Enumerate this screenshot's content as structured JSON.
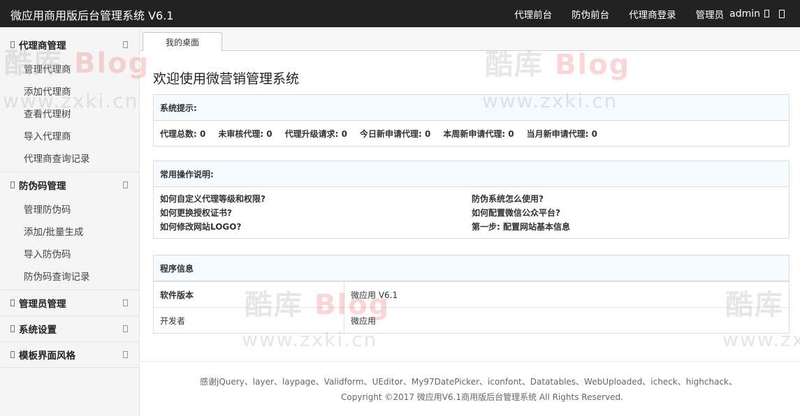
{
  "header": {
    "title": "微应用商用版后台管理系统 V6.1",
    "nav": [
      "代理前台",
      "防伪前台",
      "代理商登录"
    ],
    "role": "管理员",
    "user": "admin"
  },
  "sidebar": {
    "groups": [
      {
        "label": "代理商管理",
        "items": [
          "管理代理商",
          "添加代理商",
          "查看代理树",
          "导入代理商",
          "代理商查询记录"
        ]
      },
      {
        "label": "防伪码管理",
        "items": [
          "管理防伪码",
          "添加/批量生成",
          "导入防伪码",
          "防伪码查询记录"
        ]
      },
      {
        "label": "管理员管理",
        "items": []
      },
      {
        "label": "系统设置",
        "items": []
      },
      {
        "label": "模板界面风格",
        "items": []
      }
    ]
  },
  "tabs": [
    {
      "label": "我的桌面"
    }
  ],
  "main": {
    "welcome": "欢迎使用微营销管理系统",
    "system_panel": {
      "title": "系统提示:",
      "stats": [
        "代理总数: 0",
        "未审核代理: 0",
        "代理升级请求: 0",
        "今日新申请代理: 0",
        "本周新申请代理: 0",
        "当月新申请代理: 0"
      ]
    },
    "help_panel": {
      "title": "常用操作说明:",
      "links": [
        "如何自定义代理等级和权限?",
        "防伪系统怎么使用?",
        "如何更换授权证书?",
        "如何配置微信公众平台?",
        "如何修改网站LOGO?",
        "第一步: 配置网站基本信息"
      ]
    },
    "program_panel": {
      "title": "程序信息",
      "rows": [
        {
          "label": "软件版本",
          "value": "微应用 V6.1"
        },
        {
          "label": "开发者",
          "value": "微应用"
        }
      ]
    }
  },
  "footer": {
    "credits": "感谢jQuery、layer、laypage、Validform、UEditor、My97DatePicker、iconfont、Datatables、WebUploaded、icheck、highchack、",
    "copyright": "Copyright ©2017 微应用V6.1商用版后台管理系统 All Rights Reserved."
  },
  "watermark": {
    "brand_cn": "酷库",
    "brand_en": "Blog",
    "url": "www.zxki.cn"
  }
}
